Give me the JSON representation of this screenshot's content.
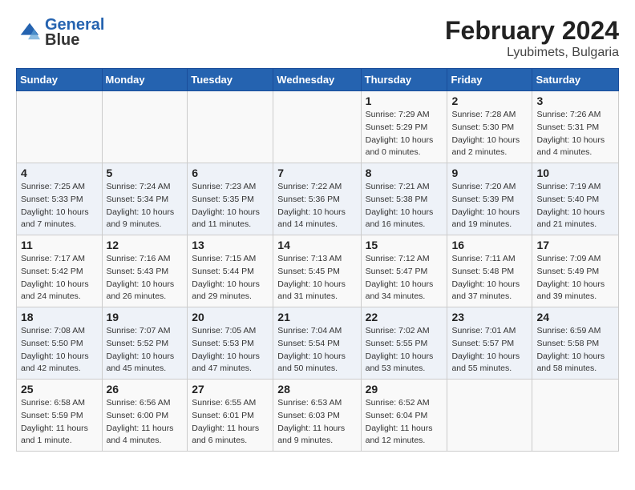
{
  "header": {
    "logo_line1": "General",
    "logo_line2": "Blue",
    "month_year": "February 2024",
    "location": "Lyubimets, Bulgaria"
  },
  "weekdays": [
    "Sunday",
    "Monday",
    "Tuesday",
    "Wednesday",
    "Thursday",
    "Friday",
    "Saturday"
  ],
  "weeks": [
    [
      {
        "day": "",
        "info": ""
      },
      {
        "day": "",
        "info": ""
      },
      {
        "day": "",
        "info": ""
      },
      {
        "day": "",
        "info": ""
      },
      {
        "day": "1",
        "info": "Sunrise: 7:29 AM\nSunset: 5:29 PM\nDaylight: 10 hours\nand 0 minutes."
      },
      {
        "day": "2",
        "info": "Sunrise: 7:28 AM\nSunset: 5:30 PM\nDaylight: 10 hours\nand 2 minutes."
      },
      {
        "day": "3",
        "info": "Sunrise: 7:26 AM\nSunset: 5:31 PM\nDaylight: 10 hours\nand 4 minutes."
      }
    ],
    [
      {
        "day": "4",
        "info": "Sunrise: 7:25 AM\nSunset: 5:33 PM\nDaylight: 10 hours\nand 7 minutes."
      },
      {
        "day": "5",
        "info": "Sunrise: 7:24 AM\nSunset: 5:34 PM\nDaylight: 10 hours\nand 9 minutes."
      },
      {
        "day": "6",
        "info": "Sunrise: 7:23 AM\nSunset: 5:35 PM\nDaylight: 10 hours\nand 11 minutes."
      },
      {
        "day": "7",
        "info": "Sunrise: 7:22 AM\nSunset: 5:36 PM\nDaylight: 10 hours\nand 14 minutes."
      },
      {
        "day": "8",
        "info": "Sunrise: 7:21 AM\nSunset: 5:38 PM\nDaylight: 10 hours\nand 16 minutes."
      },
      {
        "day": "9",
        "info": "Sunrise: 7:20 AM\nSunset: 5:39 PM\nDaylight: 10 hours\nand 19 minutes."
      },
      {
        "day": "10",
        "info": "Sunrise: 7:19 AM\nSunset: 5:40 PM\nDaylight: 10 hours\nand 21 minutes."
      }
    ],
    [
      {
        "day": "11",
        "info": "Sunrise: 7:17 AM\nSunset: 5:42 PM\nDaylight: 10 hours\nand 24 minutes."
      },
      {
        "day": "12",
        "info": "Sunrise: 7:16 AM\nSunset: 5:43 PM\nDaylight: 10 hours\nand 26 minutes."
      },
      {
        "day": "13",
        "info": "Sunrise: 7:15 AM\nSunset: 5:44 PM\nDaylight: 10 hours\nand 29 minutes."
      },
      {
        "day": "14",
        "info": "Sunrise: 7:13 AM\nSunset: 5:45 PM\nDaylight: 10 hours\nand 31 minutes."
      },
      {
        "day": "15",
        "info": "Sunrise: 7:12 AM\nSunset: 5:47 PM\nDaylight: 10 hours\nand 34 minutes."
      },
      {
        "day": "16",
        "info": "Sunrise: 7:11 AM\nSunset: 5:48 PM\nDaylight: 10 hours\nand 37 minutes."
      },
      {
        "day": "17",
        "info": "Sunrise: 7:09 AM\nSunset: 5:49 PM\nDaylight: 10 hours\nand 39 minutes."
      }
    ],
    [
      {
        "day": "18",
        "info": "Sunrise: 7:08 AM\nSunset: 5:50 PM\nDaylight: 10 hours\nand 42 minutes."
      },
      {
        "day": "19",
        "info": "Sunrise: 7:07 AM\nSunset: 5:52 PM\nDaylight: 10 hours\nand 45 minutes."
      },
      {
        "day": "20",
        "info": "Sunrise: 7:05 AM\nSunset: 5:53 PM\nDaylight: 10 hours\nand 47 minutes."
      },
      {
        "day": "21",
        "info": "Sunrise: 7:04 AM\nSunset: 5:54 PM\nDaylight: 10 hours\nand 50 minutes."
      },
      {
        "day": "22",
        "info": "Sunrise: 7:02 AM\nSunset: 5:55 PM\nDaylight: 10 hours\nand 53 minutes."
      },
      {
        "day": "23",
        "info": "Sunrise: 7:01 AM\nSunset: 5:57 PM\nDaylight: 10 hours\nand 55 minutes."
      },
      {
        "day": "24",
        "info": "Sunrise: 6:59 AM\nSunset: 5:58 PM\nDaylight: 10 hours\nand 58 minutes."
      }
    ],
    [
      {
        "day": "25",
        "info": "Sunrise: 6:58 AM\nSunset: 5:59 PM\nDaylight: 11 hours\nand 1 minute."
      },
      {
        "day": "26",
        "info": "Sunrise: 6:56 AM\nSunset: 6:00 PM\nDaylight: 11 hours\nand 4 minutes."
      },
      {
        "day": "27",
        "info": "Sunrise: 6:55 AM\nSunset: 6:01 PM\nDaylight: 11 hours\nand 6 minutes."
      },
      {
        "day": "28",
        "info": "Sunrise: 6:53 AM\nSunset: 6:03 PM\nDaylight: 11 hours\nand 9 minutes."
      },
      {
        "day": "29",
        "info": "Sunrise: 6:52 AM\nSunset: 6:04 PM\nDaylight: 11 hours\nand 12 minutes."
      },
      {
        "day": "",
        "info": ""
      },
      {
        "day": "",
        "info": ""
      }
    ]
  ]
}
